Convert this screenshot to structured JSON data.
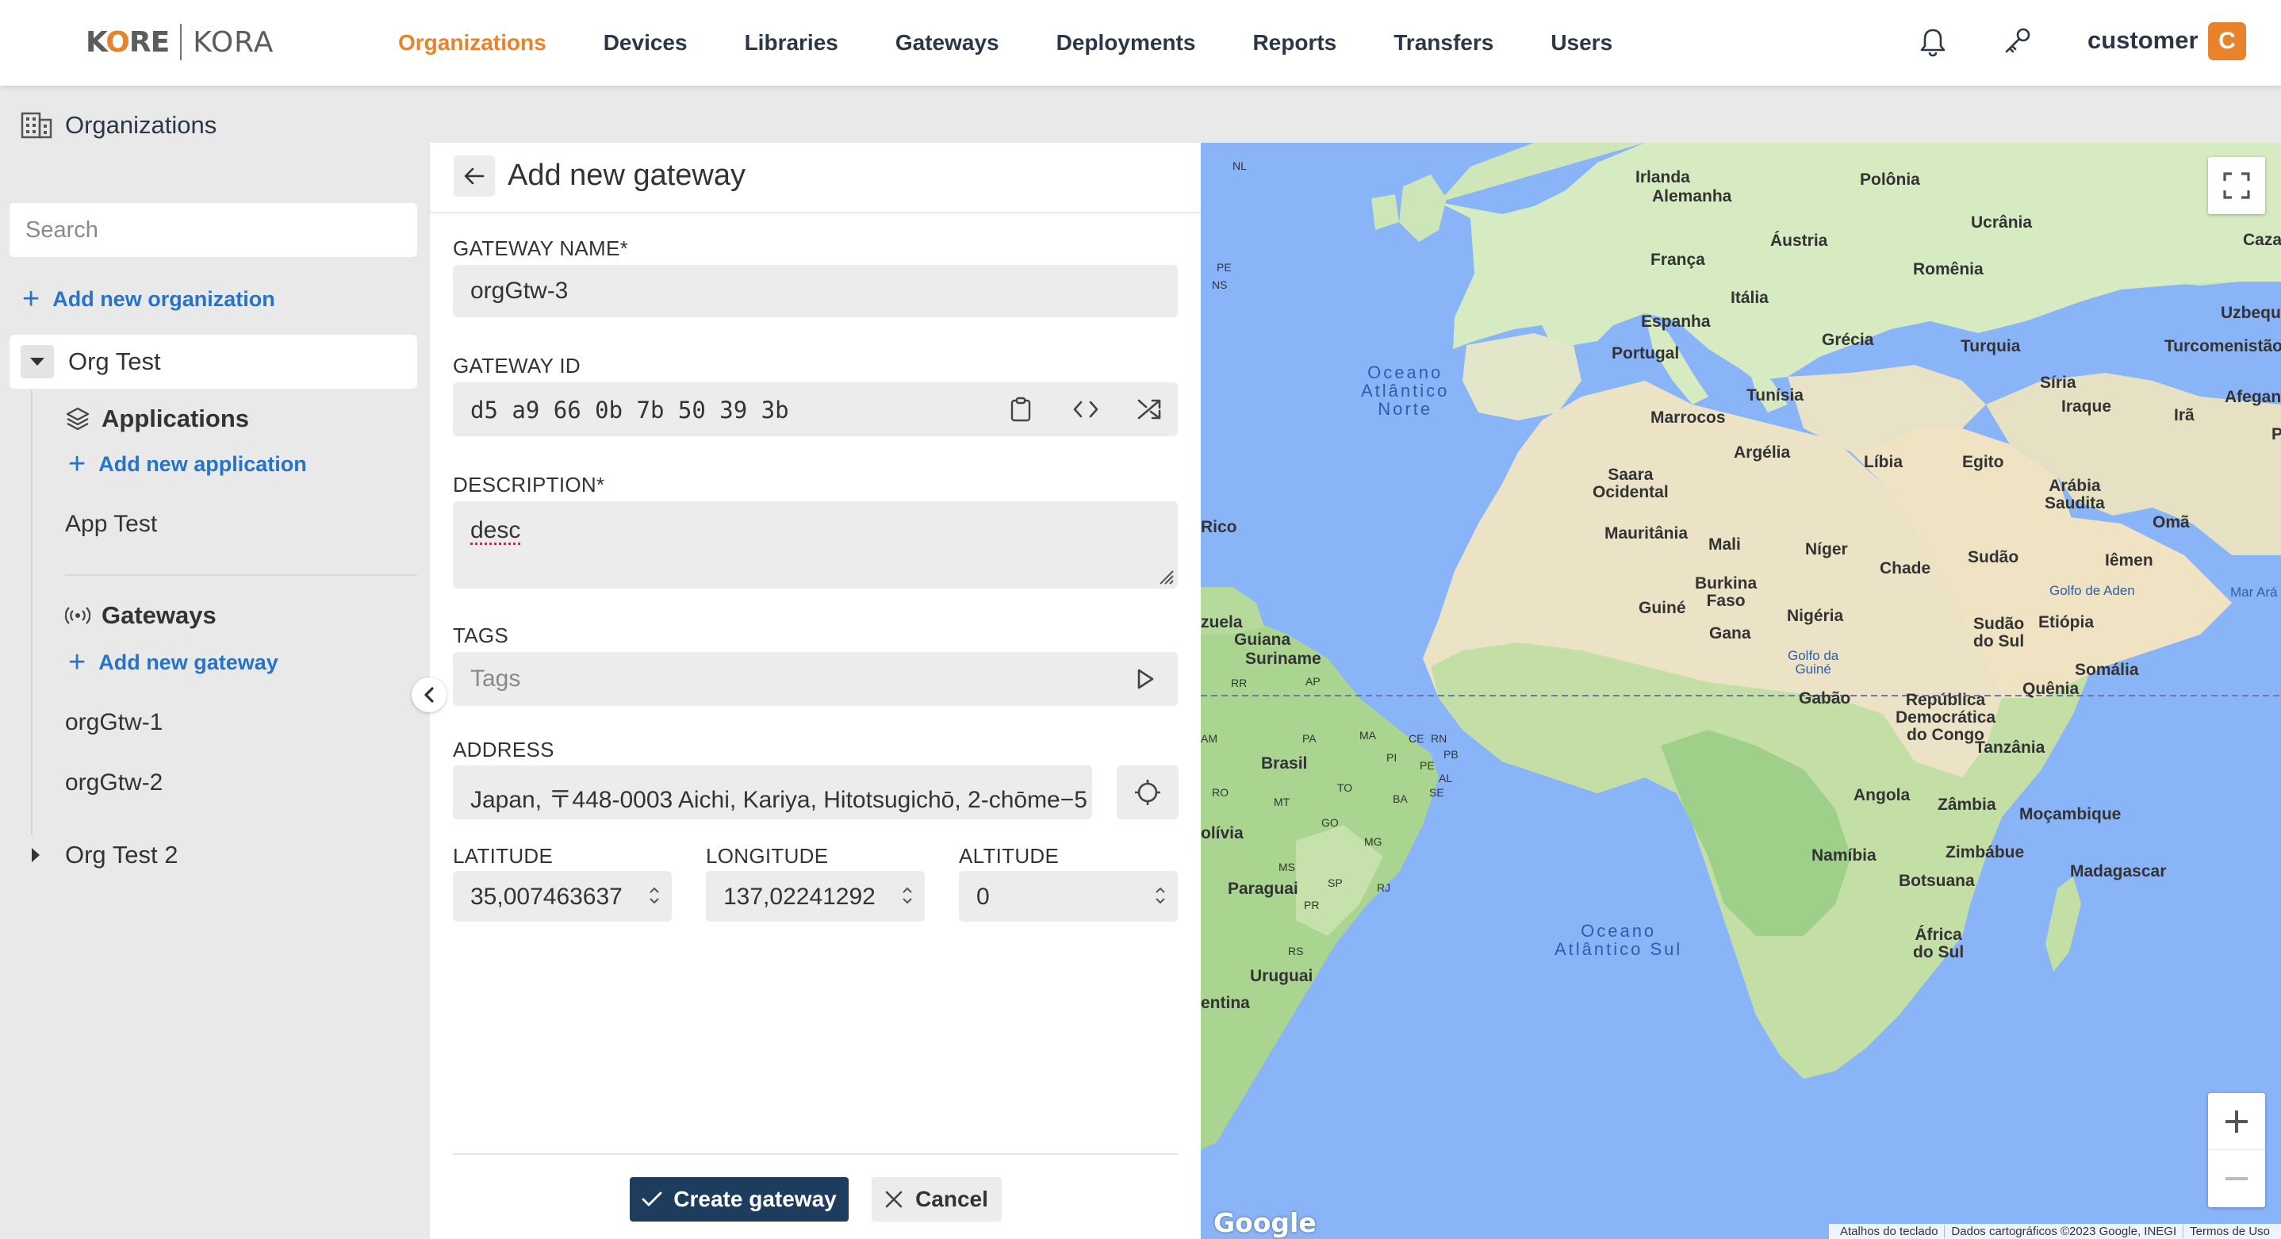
{
  "brand": {
    "name_left": "KORE",
    "name_right": "KORA"
  },
  "nav": {
    "items": [
      {
        "label": "Organizations",
        "active": true
      },
      {
        "label": "Devices"
      },
      {
        "label": "Libraries"
      },
      {
        "label": "Gateways"
      },
      {
        "label": "Deployments"
      },
      {
        "label": "Reports"
      },
      {
        "label": "Transfers"
      },
      {
        "label": "Users"
      }
    ],
    "user_name": "customer",
    "user_initial": "C"
  },
  "sidebar": {
    "title": "Organizations",
    "search_placeholder": "Search",
    "add_org": "Add new organization",
    "org1": "Org Test",
    "applications_title": "Applications",
    "add_application": "Add new application",
    "applications": [
      "App Test"
    ],
    "gateways_title": "Gateways",
    "add_gateway": "Add new gateway",
    "gateways": [
      "orgGtw-1",
      "orgGtw-2"
    ],
    "org2": "Org Test 2"
  },
  "form": {
    "title": "Add new gateway",
    "name_label": "GATEWAY NAME*",
    "name_value": "orgGtw-3",
    "id_label": "GATEWAY ID",
    "id_value": "d5 a9 66 0b 7b 50 39 3b",
    "description_label": "DESCRIPTION*",
    "description_value": "desc",
    "tags_label": "TAGS",
    "tags_placeholder": "Tags",
    "address_label": "ADDRESS",
    "address_value": "Japan, 〒448-0003 Aichi, Kariya, Hitotsugichō, 2-chōme−5",
    "latitude_label": "LATITUDE",
    "latitude_value": "35,007463637",
    "longitude_label": "LONGITUDE",
    "longitude_value": "137,02241292",
    "altitude_label": "ALTITUDE",
    "altitude_value": "0",
    "create_label": "Create gateway",
    "cancel_label": "Cancel"
  },
  "map": {
    "labels": {
      "irlanda": "Irlanda",
      "alemanha": "Alemanha",
      "polonia": "Polônia",
      "ucrania": "Ucrânia",
      "austria": "Áustria",
      "franca": "França",
      "romenia": "Romênia",
      "italia": "Itália",
      "uzbequi": "Uzbequi",
      "espanha": "Espanha",
      "grecia": "Grécia",
      "turquia": "Turquia",
      "turcomenistao": "Turcomenistão",
      "portugal": "Portugal",
      "tunisia": "Tunísia",
      "siria": "Síria",
      "afegan": "Afegan",
      "iraque": "Iraque",
      "ira": "Irã",
      "marrocos": "Marrocos",
      "argelia": "Argélia",
      "libia": "Líbia",
      "egito": "Egito",
      "saara": "Saara\nOcidental",
      "arabia": "Arábia\nSaudita",
      "oma": "Omã",
      "mauritania": "Mauritânia",
      "mali": "Mali",
      "niger": "Níger",
      "chade": "Chade",
      "sudao": "Sudão",
      "iemen": "Iêmen",
      "burkina": "Burkina\nFaso",
      "guine": "Guiné",
      "nigeria": "Nigéria",
      "gana": "Gana",
      "sudao_sul": "Sudão\ndo Sul",
      "etiopia": "Etiópia",
      "somalia": "Somália",
      "quenia": "Quênia",
      "gabao": "Gabão",
      "rdc": "República\nDemocrática\ndo Congo",
      "tanzania": "Tanzânia",
      "angola": "Angola",
      "zambia": "Zâmbia",
      "mocambique": "Moçambique",
      "namibia": "Namíbia",
      "zimbabue": "Zimbábue",
      "botsuana": "Botsuana",
      "madagascar": "Madagascar",
      "africa_sul": "África\ndo Sul",
      "guiana": "Guiana",
      "suriname": "Suriname",
      "brasil": "Brasil",
      "bolivia": "olívia",
      "paraguai": "Paraguai",
      "uruguai": "Uruguai",
      "argentina": "entina",
      "zuela": "zuela",
      "rico": "Rico",
      "caza": "Caza",
      "p": "P",
      "golfo_guine": "Golfo da\nGuiné",
      "golfo_aden": "Golfo de Aden",
      "mar_arabia": "Mar Ará",
      "oceano_norte": "Oceano\nAtlântico\nNorte",
      "oceano_sul": "Oceano\nAtlântico Sul",
      "nl": "NL",
      "pe": "PE",
      "ns": "NS",
      "ap": "AP",
      "rr": "RR",
      "pa": "PA",
      "ma": "MA",
      "ce": "CE",
      "rn": "RN",
      "pb": "PB",
      "pi": "PI",
      "pe2": "PE",
      "al": "AL",
      "se": "SE",
      "to": "TO",
      "ba": "BA",
      "am": "AM",
      "ro": "RO",
      "mt": "MT",
      "go": "GO",
      "mg": "MG",
      "ms": "MS",
      "sp": "SP",
      "rj": "RJ",
      "pr": "PR",
      "rs": "RS"
    },
    "google_logo": "Google",
    "attribution": [
      "Atalhos do teclado",
      "Dados cartográficos ©2023 Google, INEGI",
      "Termos de Uso"
    ]
  }
}
